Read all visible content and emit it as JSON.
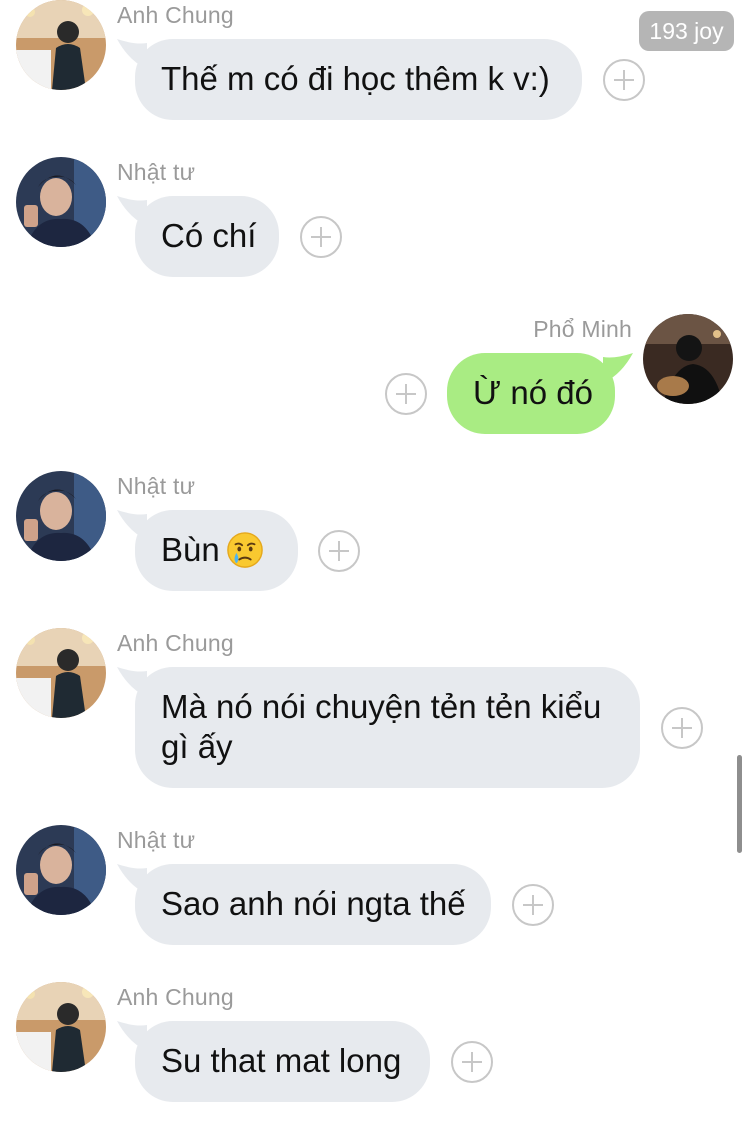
{
  "unread_badge": "193 joy",
  "colors": {
    "incoming_bubble": "#e7eaee",
    "outgoing_bubble": "#a9ec83",
    "sender_name": "#9a9a9a",
    "add_reaction_icon": "#c7c7c7"
  },
  "messages": [
    {
      "direction": "incoming",
      "sender": "Anh Chung",
      "text": "Thế m có đi học thêm k v:)"
    },
    {
      "direction": "incoming",
      "sender": "Nhật tư",
      "text": "Có chí"
    },
    {
      "direction": "outgoing",
      "sender": "Phổ Minh",
      "text": "Ừ nó đó"
    },
    {
      "direction": "incoming",
      "sender": "Nhật tư",
      "text": "Bùn",
      "emoji": "crying-face-emoji"
    },
    {
      "direction": "incoming",
      "sender": "Anh Chung",
      "text_lines": [
        "Mà nó nói chuyện tẻn tẻn kiểu",
        "gì ấy"
      ]
    },
    {
      "direction": "incoming",
      "sender": "Nhật tư",
      "text": "Sao anh nói ngta thế"
    },
    {
      "direction": "incoming",
      "sender": "Anh Chung",
      "text": "Su that mat long"
    }
  ]
}
